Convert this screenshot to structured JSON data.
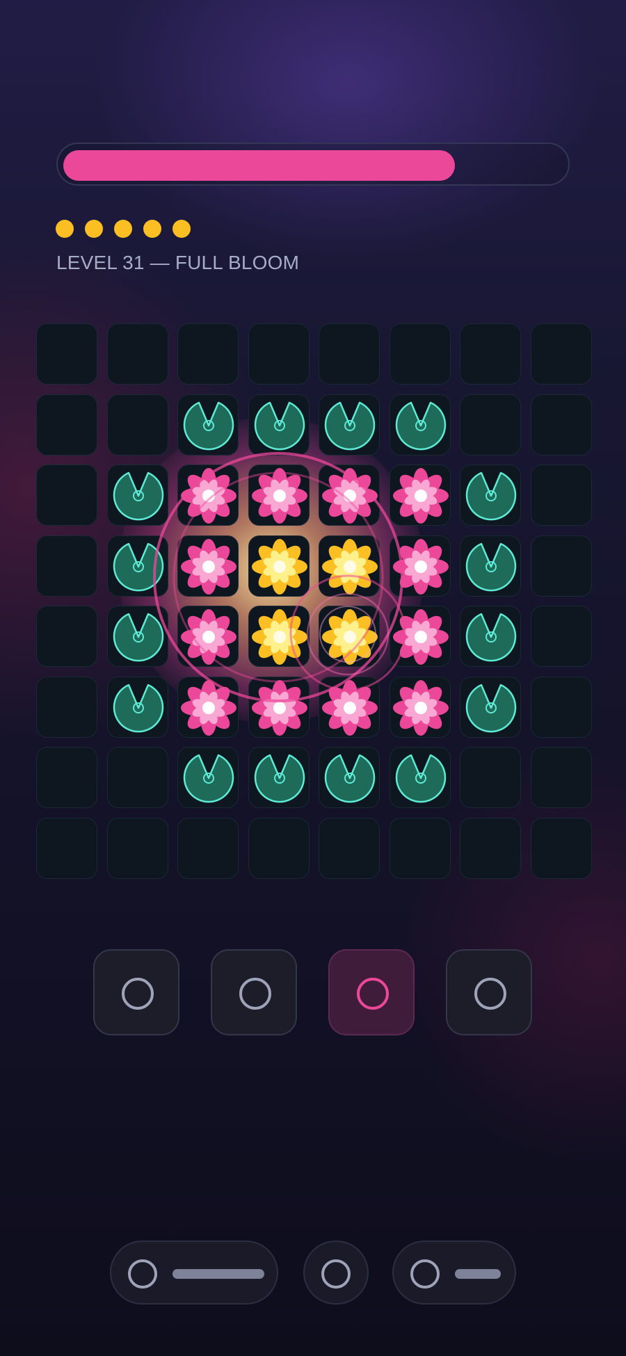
{
  "progress": {
    "fraction": 0.78,
    "color": "#ec4899"
  },
  "stars": {
    "count": 5,
    "color": "#fbbf24"
  },
  "level": {
    "title": "LEVEL 31 — FULL BLOOM"
  },
  "board": {
    "rows": [
      [
        "empty",
        "empty",
        "empty",
        "empty",
        "empty",
        "empty",
        "empty",
        "empty"
      ],
      [
        "empty",
        "empty",
        "pad",
        "pad",
        "pad",
        "pad",
        "empty",
        "empty"
      ],
      [
        "empty",
        "pad",
        "pink-flower",
        "pink-flower",
        "pink-flower",
        "pink-flower",
        "pad",
        "empty"
      ],
      [
        "empty",
        "pad",
        "pink-flower",
        "gold-flower",
        "gold-flower",
        "pink-flower",
        "pad",
        "empty"
      ],
      [
        "empty",
        "pad",
        "pink-flower",
        "gold-flower",
        "gold-flower",
        "pink-flower",
        "pad",
        "empty"
      ],
      [
        "empty",
        "pad",
        "pink-flower",
        "pink-flower",
        "pink-flower",
        "pink-flower",
        "pad",
        "empty"
      ],
      [
        "empty",
        "empty",
        "pad",
        "pad",
        "pad",
        "pad",
        "empty",
        "empty"
      ],
      [
        "empty",
        "empty",
        "empty",
        "empty",
        "empty",
        "empty",
        "empty",
        "empty"
      ]
    ],
    "colors": {
      "pad": "#1f6b5a",
      "pad_edge": "#5eead4",
      "pink": "#ec4899",
      "pink_light": "#f9a8d4",
      "gold": "#fbbf24",
      "gold_light": "#fef08a"
    }
  },
  "tools": [
    {
      "icon": "circle-icon",
      "active": false
    },
    {
      "icon": "circle-icon",
      "active": false
    },
    {
      "icon": "circle-icon",
      "active": true
    },
    {
      "icon": "circle-icon",
      "active": false
    }
  ],
  "nav": [
    {
      "icon": "circle-icon"
    },
    {
      "icon": "circle-icon"
    },
    {
      "icon": "circle-icon"
    }
  ]
}
